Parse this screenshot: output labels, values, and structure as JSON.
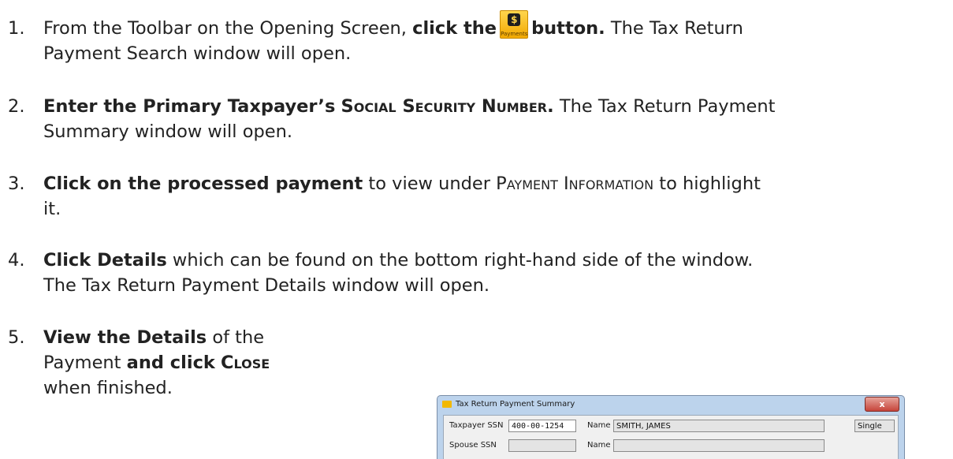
{
  "steps": [
    {
      "number": "1.",
      "line1_pre": "From the Toolbar on the Opening Screen,",
      "line1_bold": "click the",
      "line1_bold2": "button.",
      "line1_post": "The Tax Return",
      "line2": "Payment Search window will open."
    },
    {
      "number": "2.",
      "line1_bold_a": "Enter the Primary Taxpayer’s",
      "line1_bold_sc": "Social Security Number.",
      "line1_post": "The Tax Return Payment",
      "line2": "Summary window will open."
    },
    {
      "number": "3.",
      "line1_bold": "Click on the processed payment",
      "line1_mid": "to view under",
      "line1_sc": "Payment Information",
      "line1_post": "to highlight",
      "line2": "it."
    },
    {
      "number": "4.",
      "line1_bold": "Click Details",
      "line1_post": "which can be found on the bottom right-hand side of the window.",
      "line2": "The Tax Return Payment Details window will open."
    },
    {
      "number": "5.",
      "line1_bold": "View the Details",
      "line1_post": "of the",
      "line2_pre": "Payment",
      "line2_bold": "and click",
      "line2_sc": "Close",
      "line3": "when finished."
    }
  ],
  "payments_button": {
    "label": "Payments",
    "icon": "payments-icon"
  },
  "window": {
    "title": "Tax Return Payment Summary",
    "close_glyph": "x",
    "taxpayer_ssn_label": "Taxpayer SSN",
    "taxpayer_ssn_value": "400-00-1254",
    "name_label": "Name",
    "taxpayer_name_value": "SMITH, JAMES",
    "filing_status_value": "Single",
    "spouse_ssn_label": "Spouse SSN",
    "spouse_ssn_value": "",
    "spouse_name_label": "Name",
    "spouse_name_value": ""
  },
  "colors": {
    "text": "#222222",
    "payments_button": "#f7c31a",
    "window_frame": "#bcd3ec",
    "close_button": "#c6443a"
  }
}
